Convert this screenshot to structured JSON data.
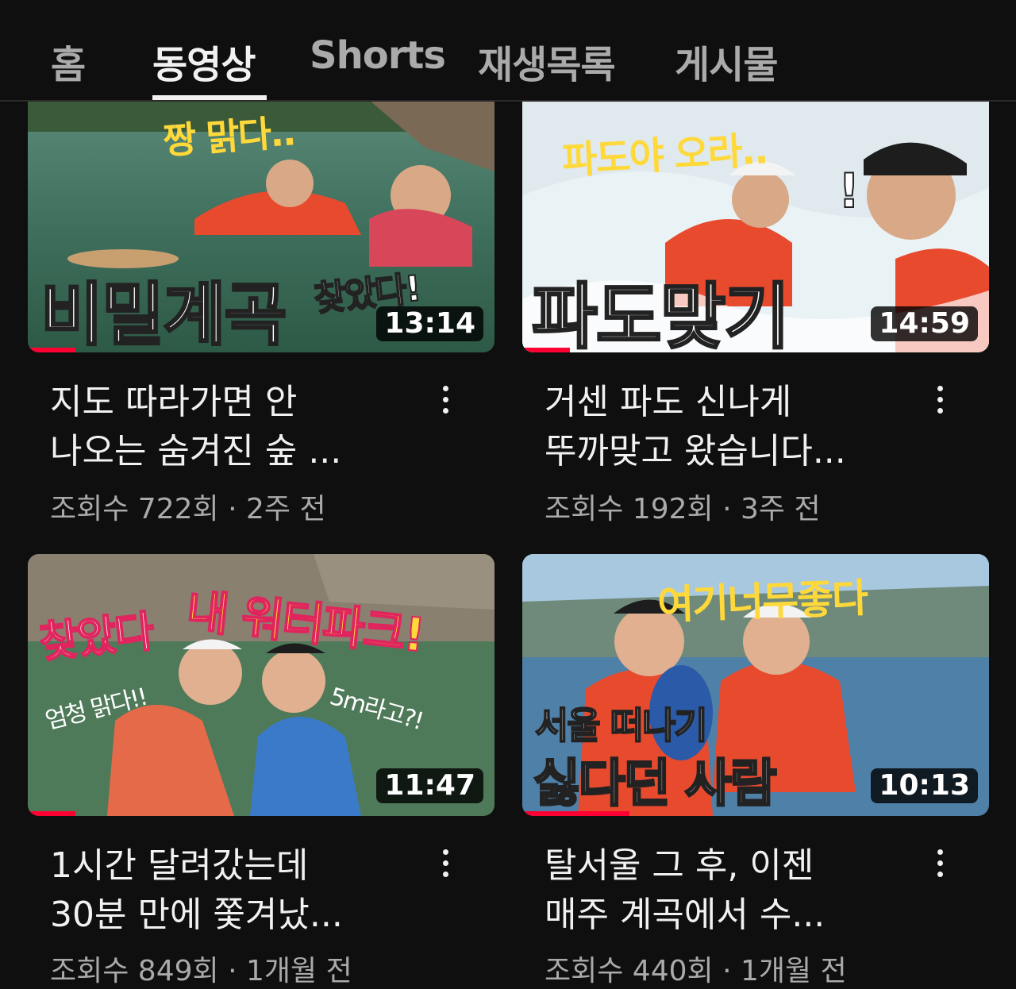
{
  "tabs": [
    {
      "label": "홈",
      "active": false
    },
    {
      "label": "동영상",
      "active": true
    },
    {
      "label": "Shorts",
      "active": false
    },
    {
      "label": "재생목록",
      "active": false
    },
    {
      "label": "게시물",
      "active": false
    }
  ],
  "videos": [
    {
      "thumb_texts": [
        "짱 맑다..",
        "비밀계곡",
        "찾았다!"
      ],
      "duration": "13:14",
      "watched_fraction": 0.1,
      "title_lines": [
        "지도 따라가면 안",
        "나오는 숨겨진 숲 ..."
      ],
      "views": "조회수 722회",
      "age": "2주 전"
    },
    {
      "thumb_texts": [
        "파도야 오라..",
        "파도맞기",
        "!"
      ],
      "duration": "14:59",
      "watched_fraction": 0.1,
      "title_lines": [
        "거센 파도 신나게",
        "뚜까맞고 왔습니다..."
      ],
      "views": "조회수 192회",
      "age": "3주 전"
    },
    {
      "thumb_texts": [
        "찾았다",
        "내 워터파크!",
        "엄청 맑다!!",
        "5m라고?!"
      ],
      "duration": "11:47",
      "watched_fraction": 0.1,
      "title_lines": [
        "1시간 달려갔는데",
        "30분 만에 쫓겨났..."
      ],
      "views": "조회수 849회",
      "age": "1개월 전"
    },
    {
      "thumb_texts": [
        "여기너무좋다",
        "서울 떠나기",
        "싫다던 사람"
      ],
      "duration": "10:13",
      "watched_fraction": 0.23,
      "title_lines": [
        "탈서울 그 후, 이젠",
        "매주 계곡에서 수..."
      ],
      "views": "조회수 440회",
      "age": "1개월 전"
    }
  ],
  "meta_separator": "·",
  "colors": {
    "background": "#0f0f0f",
    "text_primary": "#f1f1f1",
    "text_secondary": "#aaaaaa",
    "progress": "#ff0033",
    "thumb_yellow": "#ffd83a",
    "thumb_pink": "#ff3a7a"
  },
  "icons": [
    "more-vert-icon"
  ]
}
